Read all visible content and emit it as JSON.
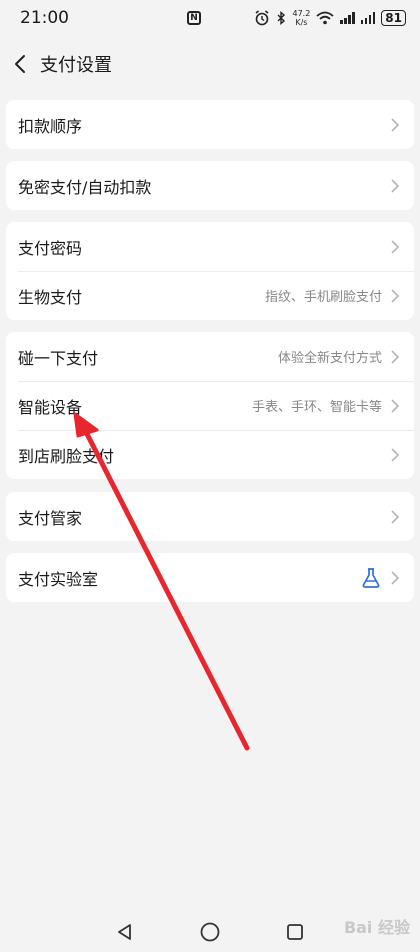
{
  "status_bar": {
    "time": "21:00",
    "net_speed_value": "47.2",
    "net_speed_unit": "K/s",
    "battery": "81"
  },
  "nav": {
    "title": "支付设置"
  },
  "groups": [
    [
      {
        "label": "扣款顺序",
        "sub": ""
      }
    ],
    [
      {
        "label": "免密支付/自动扣款",
        "sub": ""
      }
    ],
    [
      {
        "label": "支付密码",
        "sub": ""
      },
      {
        "label": "生物支付",
        "sub": "指纹、手机刷脸支付"
      }
    ],
    [
      {
        "label": "碰一下支付",
        "sub": "体验全新支付方式"
      },
      {
        "label": "智能设备",
        "sub": "手表、手环、智能卡等"
      },
      {
        "label": "到店刷脸支付",
        "sub": ""
      }
    ],
    [
      {
        "label": "支付管家",
        "sub": ""
      }
    ],
    [
      {
        "label": "支付实验室",
        "sub": ""
      }
    ]
  ],
  "icons": {
    "back": "back-icon",
    "chevron": "chevron-right-icon",
    "lab": "flask-icon",
    "sys_back": "triangle-back-icon",
    "sys_home": "circle-home-icon",
    "sys_recent": "square-recent-icon"
  },
  "colors": {
    "accent_blue": "#2f6fe4",
    "annotation_red": "#e8262d"
  },
  "watermark": "Bai 经验"
}
